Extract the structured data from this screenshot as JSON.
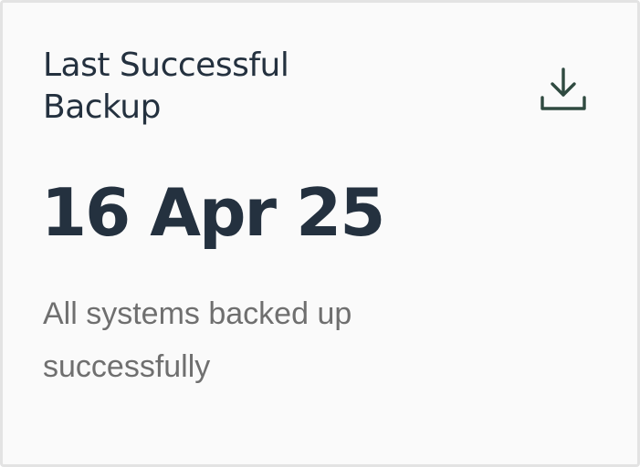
{
  "card": {
    "title": "Last Successful\nBackup",
    "value": "16 Apr 25",
    "description": "All systems backed up successfully",
    "icon": "download-icon",
    "icon_color": "#2f4a40",
    "text_color": "#24313f",
    "muted_color": "#6f6f6f"
  }
}
